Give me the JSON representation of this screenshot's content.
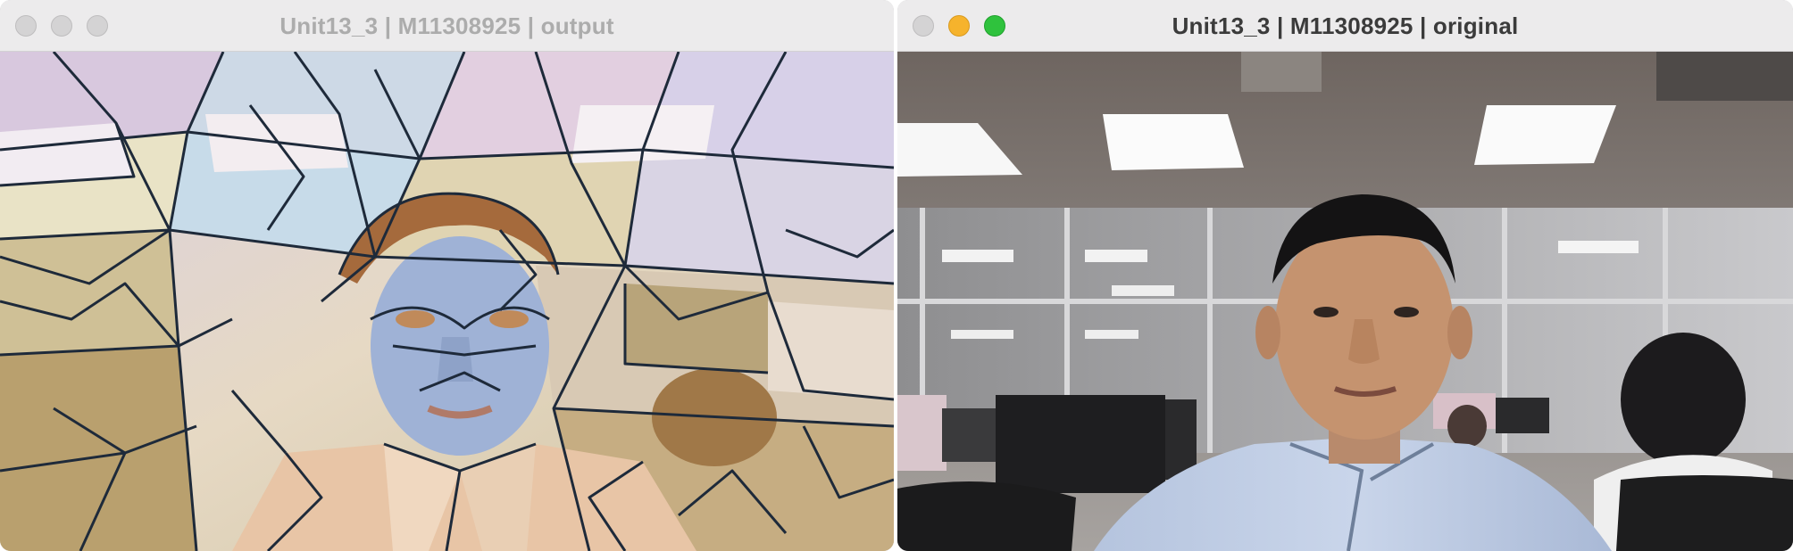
{
  "windows": [
    {
      "title": "Unit13_3 | M11308925 | output",
      "state": "inactive",
      "content": "stained-glass-filtered-webcam-frame"
    },
    {
      "title": "Unit13_3 | M11308925 | original",
      "state": "active",
      "content": "webcam-frame"
    }
  ],
  "colors": {
    "close": "#d4d3d4",
    "minimize": "#f6b32c",
    "maximize": "#2fc23d"
  }
}
